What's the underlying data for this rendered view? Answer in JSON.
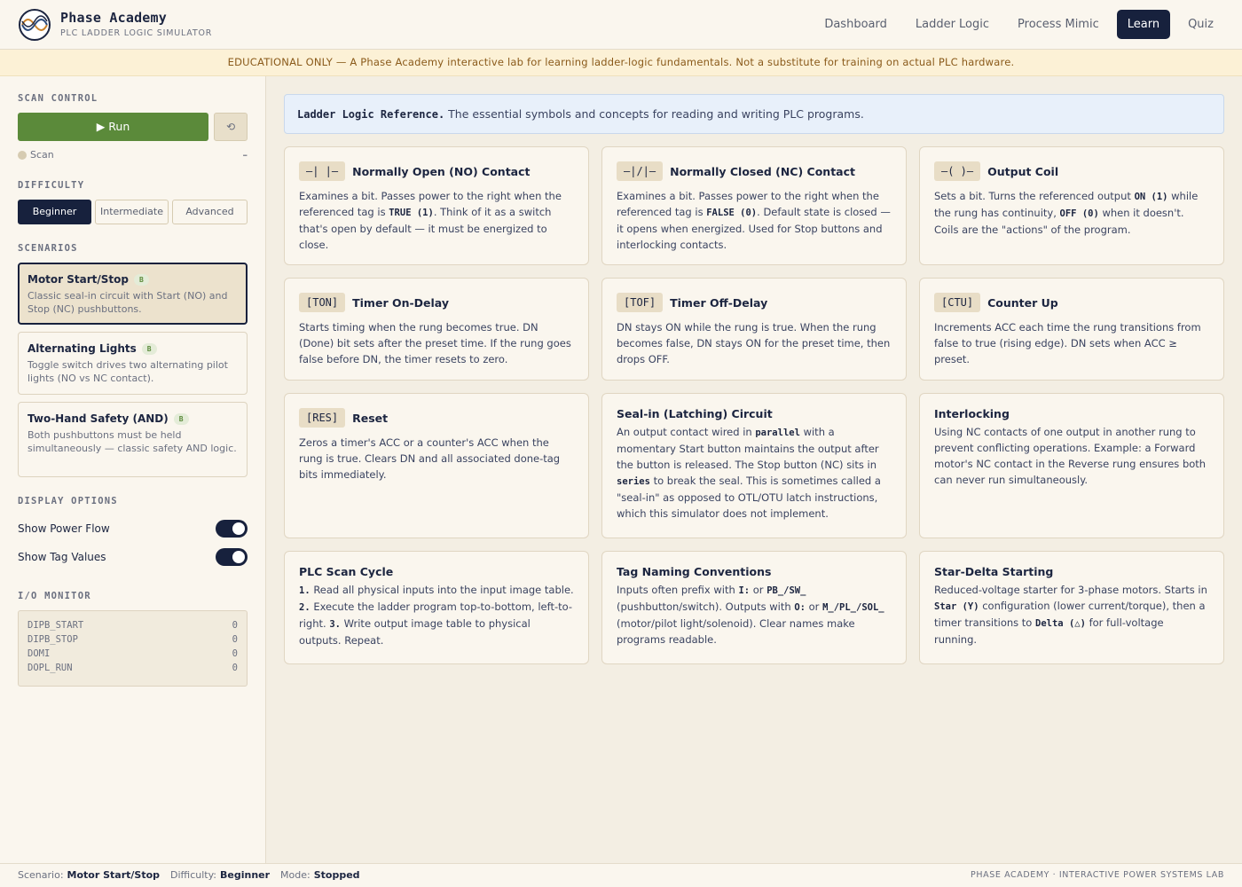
{
  "header": {
    "title": "Phase Academy",
    "subtitle": "PLC LADDER LOGIC SIMULATOR",
    "nav": [
      "Dashboard",
      "Ladder Logic",
      "Process Mimic",
      "Learn",
      "Quiz"
    ],
    "active_nav": "Learn"
  },
  "banner": "EDUCATIONAL ONLY — A Phase Academy interactive lab for learning ladder-logic fundamentals. Not a substitute for training on actual PLC hardware.",
  "sidebar": {
    "scan_control_label": "SCAN CONTROL",
    "run_label": "▶ Run",
    "reset_label": "⟲",
    "scan_label": "Scan",
    "scan_value": "–",
    "difficulty_label": "DIFFICULTY",
    "difficulties": [
      "Beginner",
      "Intermediate",
      "Advanced"
    ],
    "scenarios_label": "SCENARIOS",
    "scenarios": [
      {
        "title": "Motor Start/Stop",
        "badge": "B",
        "desc": "Classic seal-in circuit with Start (NO) and Stop (NC) pushbuttons."
      },
      {
        "title": "Alternating Lights",
        "badge": "B",
        "desc": "Toggle switch drives two alternating pilot lights (NO vs NC contact)."
      },
      {
        "title": "Two-Hand Safety (AND)",
        "badge": "B",
        "desc": "Both pushbuttons must be held simultaneously — classic safety AND logic."
      }
    ],
    "display_label": "DISPLAY OPTIONS",
    "options": [
      {
        "label": "Show Power Flow",
        "on": true
      },
      {
        "label": "Show Tag Values",
        "on": true
      }
    ],
    "io_label": "I/O MONITOR",
    "io": [
      {
        "tag": "DIPB_START",
        "value": "0"
      },
      {
        "tag": "DIPB_STOP",
        "value": "0"
      },
      {
        "tag": "DOMI",
        "value": "0"
      },
      {
        "tag": "DOPL_RUN",
        "value": "0"
      }
    ]
  },
  "main": {
    "ref_title": "Ladder Logic Reference.",
    "ref_desc": "The essential symbols and concepts for reading and writing PLC programs.",
    "cards": [
      {
        "sym": "—| |—",
        "title": "Normally Open (NO) Contact"
      },
      {
        "sym": "—|/|—",
        "title": "Normally Closed (NC) Contact"
      },
      {
        "sym": "—( )—",
        "title": "Output Coil"
      },
      {
        "sym": "[TON]",
        "title": "Timer On-Delay"
      },
      {
        "sym": "[TOF]",
        "title": "Timer Off-Delay"
      },
      {
        "sym": "[CTU]",
        "title": "Counter Up"
      },
      {
        "sym": "[RES]",
        "title": "Reset"
      },
      {
        "sym": "",
        "title": "Seal-in (Latching) Circuit"
      },
      {
        "sym": "",
        "title": "Interlocking"
      },
      {
        "sym": "",
        "title": "PLC Scan Cycle"
      },
      {
        "sym": "",
        "title": "Tag Naming Conventions"
      },
      {
        "sym": "",
        "title": "Star-Delta Starting"
      }
    ],
    "texts": {
      "no_1": "Examines a bit. Passes power to the right when the referenced tag is",
      "no_code": "TRUE (1)",
      "no_2": ". Think of it as a switch that's open by default — it must be energized to close.",
      "nc_1": "Examines a bit. Passes power to the right when the referenced tag is",
      "nc_code": "FALSE (0)",
      "nc_2": ". Default state is closed — it opens when energized. Used for Stop buttons and interlocking contacts.",
      "coil_1": "Sets a bit. Turns the referenced output",
      "coil_code1": "ON (1)",
      "coil_2": "while the rung has continuity,",
      "coil_code2": "OFF (0)",
      "coil_3": "when it doesn't. Coils are the \"actions\" of the program.",
      "ton": "Starts timing when the rung becomes true. DN (Done) bit sets after the preset time. If the rung goes false before DN, the timer resets to zero.",
      "tof": "DN stays ON while the rung is true. When the rung becomes false, DN stays ON for the preset time, then drops OFF.",
      "ctu": "Increments ACC each time the rung transitions from false to true (rising edge). DN sets when ACC ≥ preset.",
      "res": "Zeros a timer's ACC or a counter's ACC when the rung is true. Clears DN and all associated done-tag bits immediately.",
      "seal_1": "An output contact wired in",
      "seal_code1": "parallel",
      "seal_2": "with a momentary Start button maintains the output after the button is released. The Stop button (NC) sits in",
      "seal_code2": "series",
      "seal_3": "to break the seal. This is sometimes called a \"seal-in\" as opposed to OTL/OTU latch instructions, which this simulator does not implement.",
      "interlock": "Using NC contacts of one output in another rung to prevent conflicting operations. Example: a Forward motor's NC contact in the Reverse rung ensures both can never run simultaneously.",
      "scan_n1": "1.",
      "scan_1": "Read all physical inputs into the input image table.",
      "scan_n2": "2.",
      "scan_2": "Execute the ladder program top-to-bottom, left-to-right.",
      "scan_n3": "3.",
      "scan_3": "Write output image table to physical outputs. Repeat.",
      "tag_1": "Inputs often prefix with",
      "tag_c1": "I:",
      "tag_2": "or",
      "tag_c2": "PB_/SW_",
      "tag_3": "(pushbutton/switch). Outputs with",
      "tag_c3": "O:",
      "tag_4": "or",
      "tag_c4": "M_/PL_/SOL_",
      "tag_5": "(motor/pilot light/solenoid). Clear names make programs readable.",
      "star_1": "Reduced-voltage starter for 3-phase motors. Starts in",
      "star_c1": "Star (Y)",
      "star_2": "configuration (lower current/torque), then a timer transitions to",
      "star_c2": "Delta (△)",
      "star_3": "for full-voltage running."
    }
  },
  "footer": {
    "scenario_label": "Scenario:",
    "scenario_value": "Motor Start/Stop",
    "difficulty_label": "Difficulty:",
    "difficulty_value": "Beginner",
    "mode_label": "Mode:",
    "mode_value": "Stopped",
    "right": "PHASE ACADEMY · INTERACTIVE POWER SYSTEMS LAB"
  },
  "colors": {
    "navy": "#17213d",
    "run_green": "#5b8a3a",
    "background": "#f3eee3",
    "banner_bg": "#fcf1d6"
  }
}
